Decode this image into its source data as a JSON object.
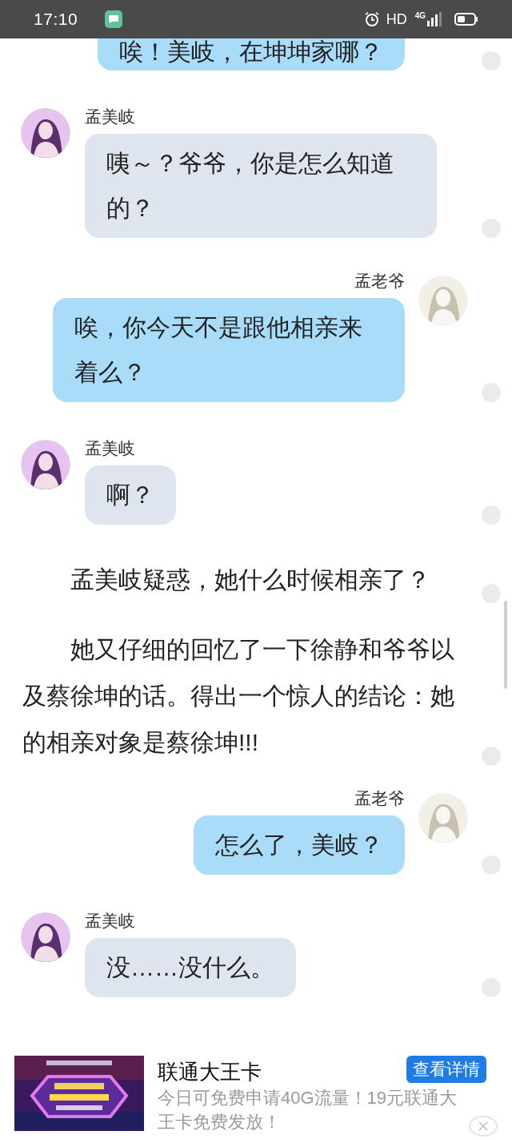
{
  "status_bar": {
    "time": "17:10",
    "network_label": "HD",
    "signal_label": "4G"
  },
  "feed": [
    {
      "kind": "outgoing",
      "text": "唉！美岐，在坤坤家哪？"
    },
    {
      "kind": "incoming",
      "sender": "孟美岐",
      "text": "咦～？爷爷，你是怎么知道的？"
    },
    {
      "kind": "outgoing",
      "sender": "孟老爷",
      "text": "唉，你今天不是跟他相亲来着么？"
    },
    {
      "kind": "incoming",
      "sender": "孟美岐",
      "text": "啊？"
    },
    {
      "kind": "narration",
      "text": "孟美岐疑惑，她什么时候相亲了？"
    },
    {
      "kind": "narration",
      "text": "她又仔细的回忆了一下徐静和爷爷以及蔡徐坤的话。得出一个惊人的结论：她的相亲对象是蔡徐坤!!!"
    },
    {
      "kind": "outgoing",
      "sender": "孟老爷",
      "text": "怎么了，美岐？"
    },
    {
      "kind": "incoming",
      "sender": "孟美岐",
      "text": "没……没什么。"
    }
  ],
  "ad": {
    "title": "联通大王卡",
    "description": "今日可免费申请40G流量！19元联通大王卡免费发放！",
    "button": "查看详情"
  }
}
